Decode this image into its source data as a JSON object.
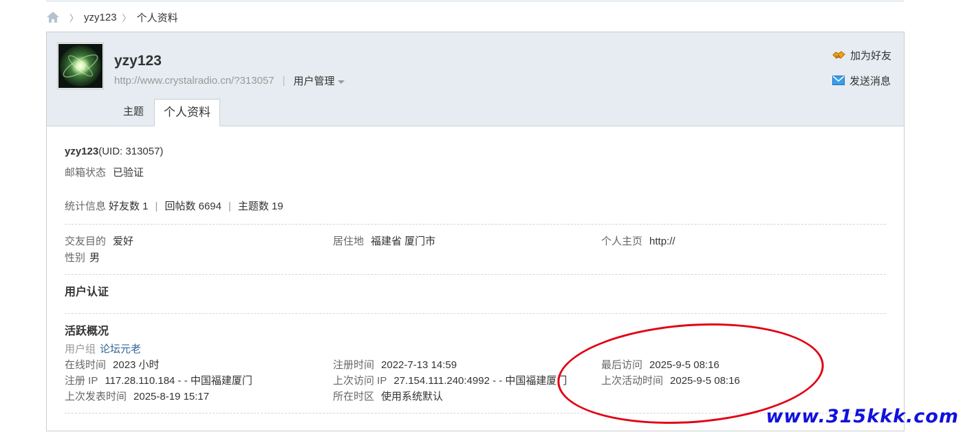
{
  "breadcrumb": {
    "items": [
      "yzy123",
      "个人资料"
    ]
  },
  "header": {
    "username": "yzy123",
    "url": "http://www.crystalradio.cn/?313057",
    "manage_label": "用户管理",
    "add_friend": "加为好友",
    "send_message": "发送消息",
    "tabs": [
      {
        "label": "主题"
      },
      {
        "label": "个人资料"
      }
    ]
  },
  "profile": {
    "name": "yzy123",
    "uid": "(UID: 313057)",
    "email_label": "邮箱状态",
    "email_value": "已验证",
    "stats_label": "统计信息",
    "friends": "好友数 1",
    "replies": "回帖数 6694",
    "topics": "主题数 19",
    "purpose_label": "交友目的",
    "purpose_value": "爱好",
    "residence_label": "居住地",
    "residence_value": "福建省 厦门市",
    "homepage_label": "个人主页",
    "homepage_value": "http://",
    "gender_label": "性别",
    "gender_value": "男",
    "cert_title": "用户认证",
    "activity_title": "活跃概况",
    "group_label": "用户组",
    "group_value": "论坛元老",
    "online_label": "在线时间",
    "online_value": "2023 小时",
    "reg_time_label": "注册时间",
    "reg_time_value": "2022-7-13 14:59",
    "last_visit_label": "最后访问",
    "last_visit_value": "2025-9-5 08:16",
    "reg_ip_label": "注册 IP",
    "reg_ip_value": "117.28.110.184 - - 中国福建厦门",
    "last_ip_label": "上次访问 IP",
    "last_ip_value": "27.154.111.240:4992 - - 中国福建厦门",
    "last_active_label": "上次活动时间",
    "last_active_value": "2025-9-5 08:16",
    "last_post_label": "上次发表时间",
    "last_post_value": "2025-8-19 15:17",
    "timezone_label": "所在时区",
    "timezone_value": "使用系统默认"
  },
  "watermark": "www.315kkk.com",
  "colors": {
    "header_bg": "#e6ecf1",
    "link": "#336699",
    "annotation": "#e10012",
    "watermark": "#1111dd"
  }
}
